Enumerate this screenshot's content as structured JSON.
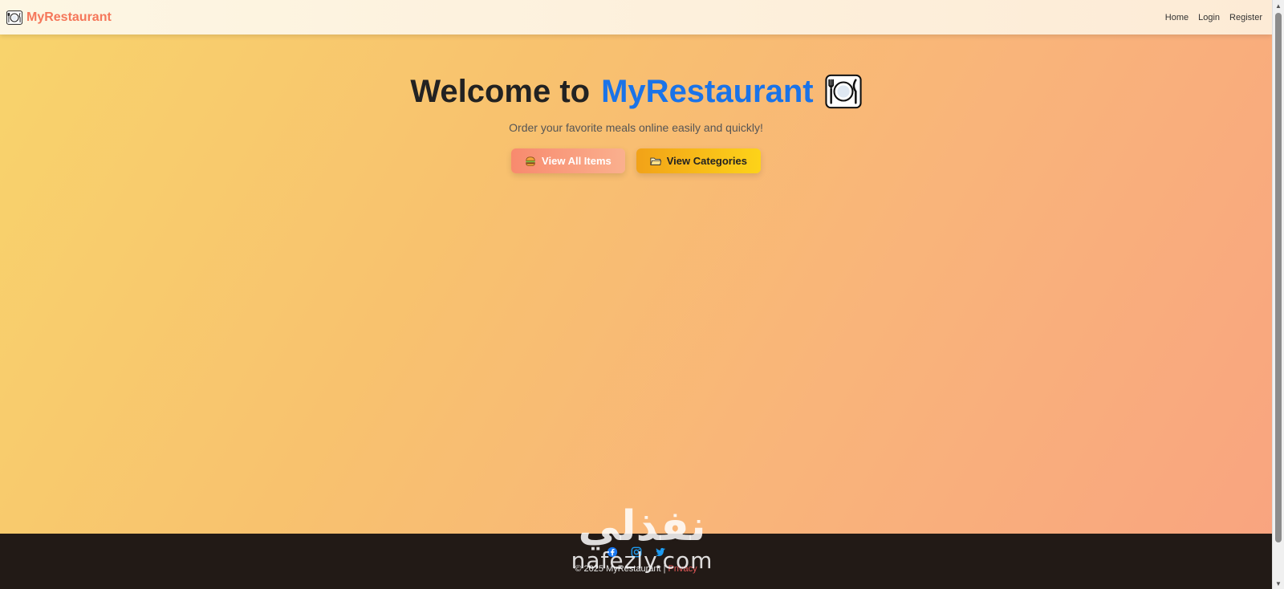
{
  "navbar": {
    "brand_name": "MyRestaurant",
    "brand_icon": "plate-cutlery-icon",
    "links": [
      "Home",
      "Login",
      "Register"
    ]
  },
  "hero": {
    "title_prefix": "Welcome to",
    "title_accent": "MyRestaurant",
    "title_icon": "plate-cutlery-icon",
    "subtitle": "Order your favorite meals online easily and quickly!",
    "buttons": [
      {
        "label": "View All Items",
        "icon": "burger-icon"
      },
      {
        "label": "View Categories",
        "icon": "folder-icon"
      }
    ]
  },
  "footer": {
    "social": [
      "facebook-icon",
      "instagram-icon",
      "twitter-icon"
    ],
    "copyright": "© 2025 MyRestaurant |",
    "link_label": "Privacy"
  },
  "watermark": {
    "arabic": "نفذلي",
    "latin": "nafezly.com"
  },
  "colors": {
    "brand": "#f5775a",
    "accent": "#1a73e8",
    "footer_bg": "#221a16",
    "footer_link": "#e85a5a",
    "btn_items": "#f88a6e",
    "btn_categories": "#fdd319"
  }
}
